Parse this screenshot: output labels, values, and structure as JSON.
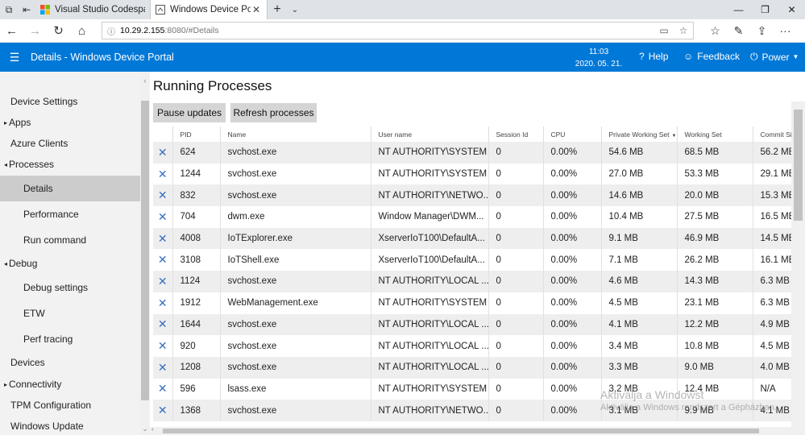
{
  "browser": {
    "tabs": [
      {
        "label": "Visual Studio Codespaces -",
        "active": false
      },
      {
        "label": "Windows Device Portal",
        "active": true
      }
    ],
    "address": {
      "host": "10.29.2.155",
      "rest": ":8080/#Details"
    }
  },
  "header": {
    "title": "Details - Windows Device Portal",
    "time": "11:03",
    "date": "2020. 05. 21.",
    "help_label": "Help",
    "feedback_label": "Feedback",
    "power_label": "Power"
  },
  "sidebar": {
    "items": [
      {
        "label": "Device Settings",
        "kind": "top"
      },
      {
        "label": "Apps",
        "kind": "exp",
        "arrow": "▸"
      },
      {
        "label": "Azure Clients",
        "kind": "top"
      },
      {
        "label": "Processes",
        "kind": "exp",
        "arrow": "◂"
      },
      {
        "label": "Details",
        "kind": "sub",
        "selected": true
      },
      {
        "label": "Performance",
        "kind": "sub"
      },
      {
        "label": "Run command",
        "kind": "sub"
      },
      {
        "label": "Debug",
        "kind": "exp",
        "arrow": "◂"
      },
      {
        "label": "Debug settings",
        "kind": "sub"
      },
      {
        "label": "ETW",
        "kind": "sub"
      },
      {
        "label": "Perf tracing",
        "kind": "sub"
      },
      {
        "label": "Devices",
        "kind": "top"
      },
      {
        "label": "Connectivity",
        "kind": "exp",
        "arrow": "▸"
      },
      {
        "label": "TPM Configuration",
        "kind": "top"
      },
      {
        "label": "Windows Update",
        "kind": "top"
      }
    ]
  },
  "main": {
    "title": "Running Processes",
    "pause_label": "Pause updates",
    "refresh_label": "Refresh processes",
    "columns": [
      "",
      "PID",
      "Name",
      "User name",
      "Session Id",
      "CPU",
      "Private Working Set",
      "Working Set",
      "Commit Size"
    ],
    "rows": [
      [
        "624",
        "svchost.exe",
        "NT AUTHORITY\\SYSTEM",
        "0",
        "0.00%",
        "54.6 MB",
        "68.5 MB",
        "56.2 MB"
      ],
      [
        "1244",
        "svchost.exe",
        "NT AUTHORITY\\SYSTEM",
        "0",
        "0.00%",
        "27.0 MB",
        "53.3 MB",
        "29.1 MB"
      ],
      [
        "832",
        "svchost.exe",
        "NT AUTHORITY\\NETWO...",
        "0",
        "0.00%",
        "14.6 MB",
        "20.0 MB",
        "15.3 MB"
      ],
      [
        "704",
        "dwm.exe",
        "Window Manager\\DWM...",
        "0",
        "0.00%",
        "10.4 MB",
        "27.5 MB",
        "16.5 MB"
      ],
      [
        "4008",
        "IoTExplorer.exe",
        "XserverIoT100\\DefaultA...",
        "0",
        "0.00%",
        "9.1 MB",
        "46.9 MB",
        "14.5 MB"
      ],
      [
        "3108",
        "IoTShell.exe",
        "XserverIoT100\\DefaultA...",
        "0",
        "0.00%",
        "7.1 MB",
        "26.2 MB",
        "16.1 MB"
      ],
      [
        "1124",
        "svchost.exe",
        "NT AUTHORITY\\LOCAL ...",
        "0",
        "0.00%",
        "4.6 MB",
        "14.3 MB",
        "6.3 MB"
      ],
      [
        "1912",
        "WebManagement.exe",
        "NT AUTHORITY\\SYSTEM",
        "0",
        "0.00%",
        "4.5 MB",
        "23.1 MB",
        "6.3 MB"
      ],
      [
        "1644",
        "svchost.exe",
        "NT AUTHORITY\\LOCAL ...",
        "0",
        "0.00%",
        "4.1 MB",
        "12.2 MB",
        "4.9 MB"
      ],
      [
        "920",
        "svchost.exe",
        "NT AUTHORITY\\LOCAL ...",
        "0",
        "0.00%",
        "3.4 MB",
        "10.8 MB",
        "4.5 MB"
      ],
      [
        "1208",
        "svchost.exe",
        "NT AUTHORITY\\LOCAL ...",
        "0",
        "0.00%",
        "3.3 MB",
        "9.0 MB",
        "4.0 MB"
      ],
      [
        "596",
        "lsass.exe",
        "NT AUTHORITY\\SYSTEM",
        "0",
        "0.00%",
        "3.2 MB",
        "12.4 MB",
        "N/A"
      ],
      [
        "1368",
        "svchost.exe",
        "NT AUTHORITY\\NETWO...",
        "0",
        "0.00%",
        "3.1 MB",
        "9.9 MB",
        "4.1 MB"
      ]
    ]
  },
  "watermark": {
    "line1": "Aktiválja a Windowst",
    "line2": "Aktiválja a Windows rendszert a Gépházban."
  },
  "colors": {
    "accent": "#0078d7",
    "row_alt": "#eeeeee",
    "sidebar_bg": "#f2f2f2",
    "kill_icon": "#3a6fbf"
  }
}
